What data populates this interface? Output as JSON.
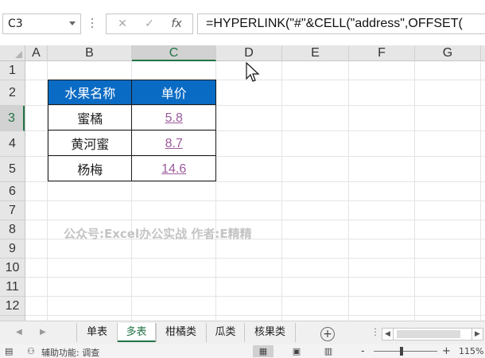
{
  "formula_bar": {
    "name_box": "C3",
    "cancel_icon": "✕",
    "enter_icon": "✓",
    "function_icon": "fx",
    "formula": "=HYPERLINK(\"#\"&CELL(\"address\",OFFSET("
  },
  "grid": {
    "columns": [
      "A",
      "B",
      "C",
      "D",
      "E",
      "F",
      "G"
    ],
    "rows": [
      "1",
      "2",
      "3",
      "4",
      "5",
      "6",
      "7",
      "8",
      "9",
      "10",
      "11",
      "12"
    ],
    "selected_cell": "C3"
  },
  "table": {
    "headers": [
      "水果名称",
      "单价"
    ],
    "rows": [
      {
        "name": "蜜橘",
        "price": "5.8"
      },
      {
        "name": "黄河蜜",
        "price": "8.7"
      },
      {
        "name": "杨梅",
        "price": "14.6"
      }
    ],
    "header_color": "#0a6bc4",
    "link_color": "#9b5a9b"
  },
  "watermark": "公众号:Excel办公实战  作者:E精精",
  "sheet_tabs": {
    "tabs": [
      "单表",
      "多表",
      "柑橘类",
      "瓜类",
      "核果类"
    ],
    "active": "多表",
    "add_icon": "plus-circle-icon"
  },
  "status_bar": {
    "accessibility": "辅助功能: 调查",
    "zoom_minus": "-",
    "zoom_plus": "+",
    "zoom": "115%"
  }
}
